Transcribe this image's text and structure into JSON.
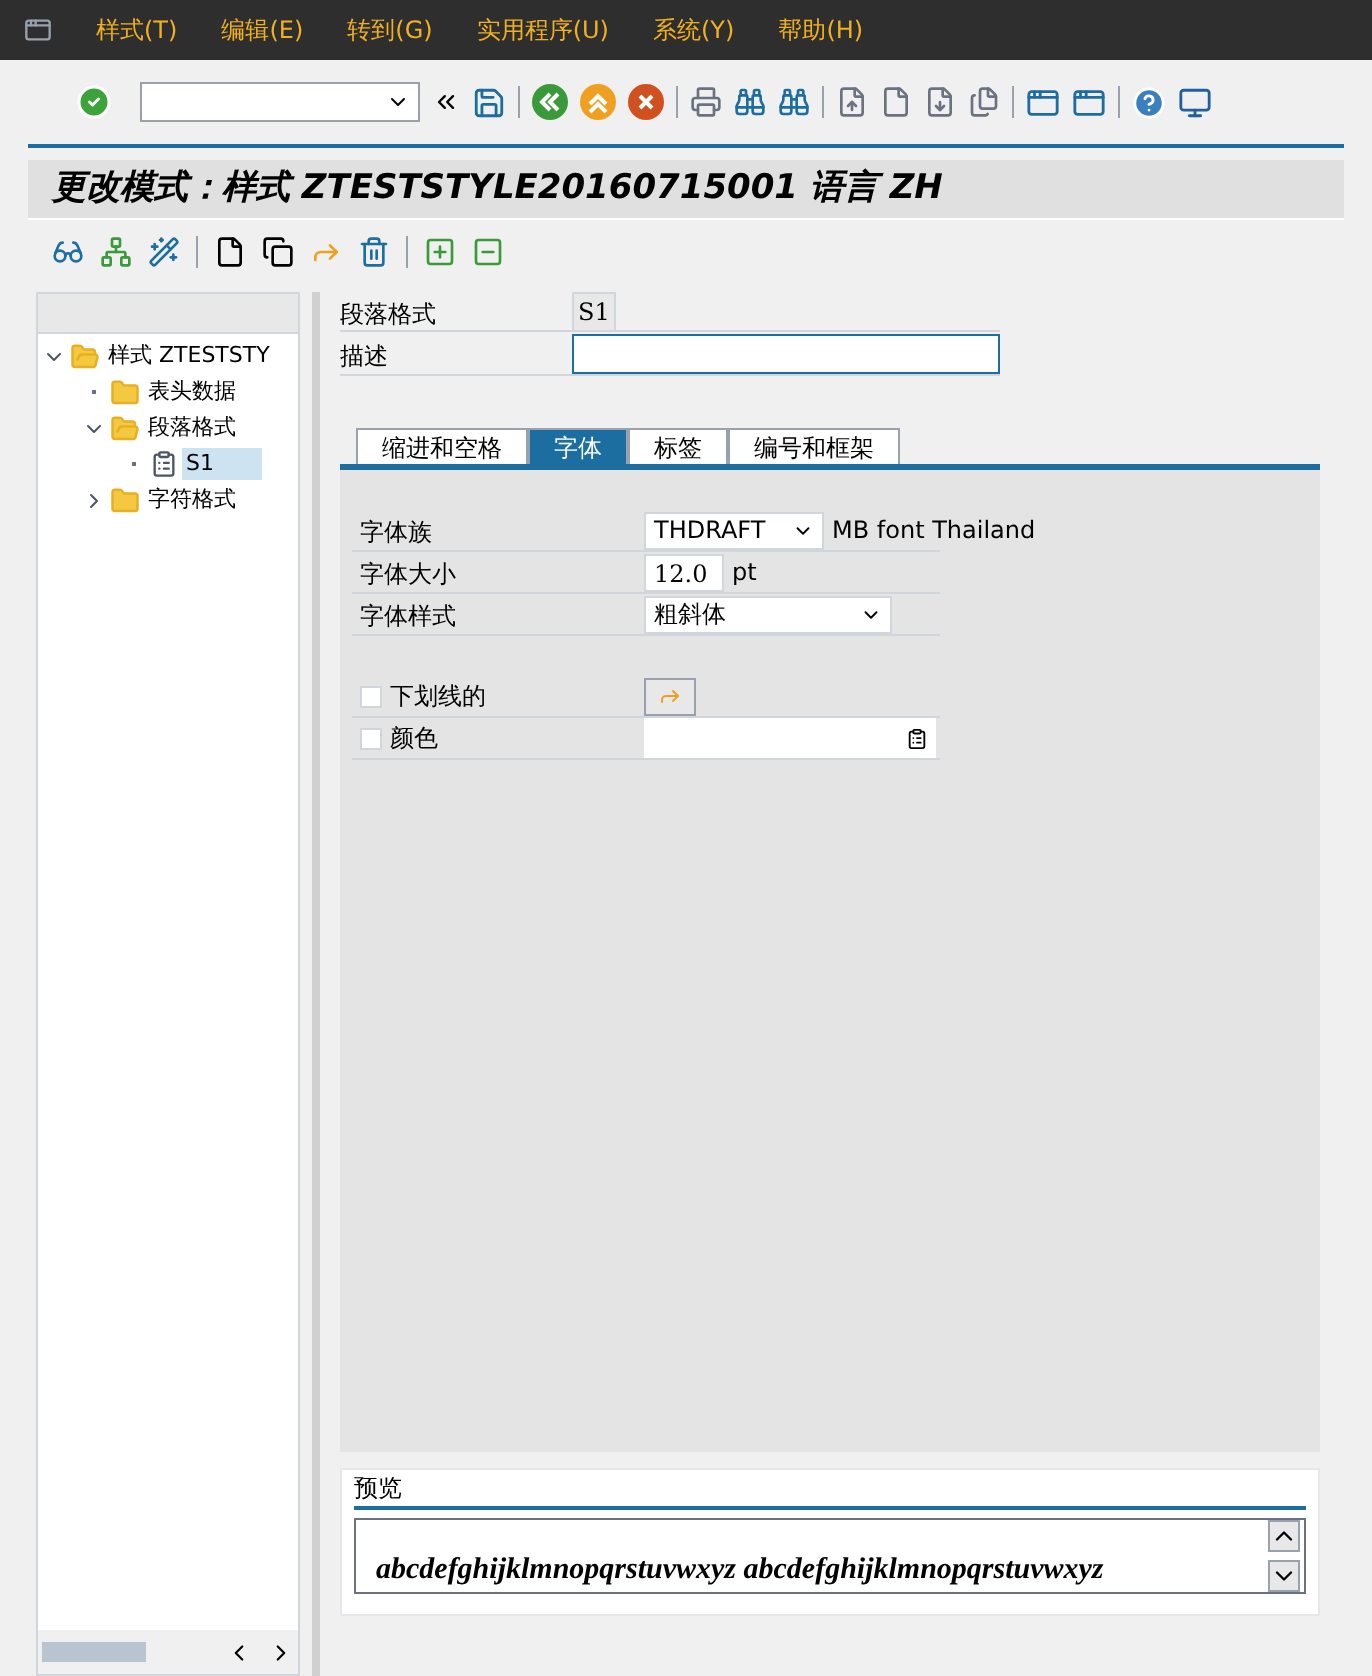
{
  "menu": [
    "样式(T)",
    "编辑(E)",
    "转到(G)",
    "实用程序(U)",
    "系统(Y)",
    "帮助(H)"
  ],
  "title": "更改模式：样式 ZTESTSTYLE20160715001 语言 ZH",
  "tree": [
    {
      "label": "样式 ZTESTSTY",
      "kind": "folder",
      "expanded": true,
      "selected": false,
      "children": [
        {
          "label": "表头数据",
          "kind": "folder",
          "selected": false
        },
        {
          "label": "段落格式",
          "kind": "folder",
          "expanded": true,
          "selected": false,
          "children": [
            {
              "label": "S1",
              "kind": "doc",
              "selected": true
            }
          ]
        },
        {
          "label": "字符格式",
          "kind": "folder",
          "expanded": false,
          "selected": false
        }
      ]
    }
  ],
  "header": {
    "paragraph_label": "段落格式",
    "paragraph_value": "S1",
    "description_label": "描述"
  },
  "tabs": [
    {
      "label": "缩进和空格",
      "selected": false
    },
    {
      "label": "字体",
      "selected": true
    },
    {
      "label": "标签",
      "selected": false
    },
    {
      "label": "编号和框架",
      "selected": false
    }
  ],
  "font": {
    "family_label": "字体族",
    "family_value": "THDRAFT",
    "family_text": "MB font Thailand",
    "size_label": "字体大小",
    "size_value": "12.0",
    "size_unit": "pt",
    "style_label": "字体样式",
    "style_value": "粗斜体"
  },
  "checks": [
    {
      "label": "下划线的",
      "checked": false
    },
    {
      "label": "颜色",
      "checked": false
    }
  ],
  "preview": {
    "title": "预览",
    "text": "abcdefghijklmnopqrstuvwxyz abcdefghijklmnopqrstuvwxyz"
  }
}
